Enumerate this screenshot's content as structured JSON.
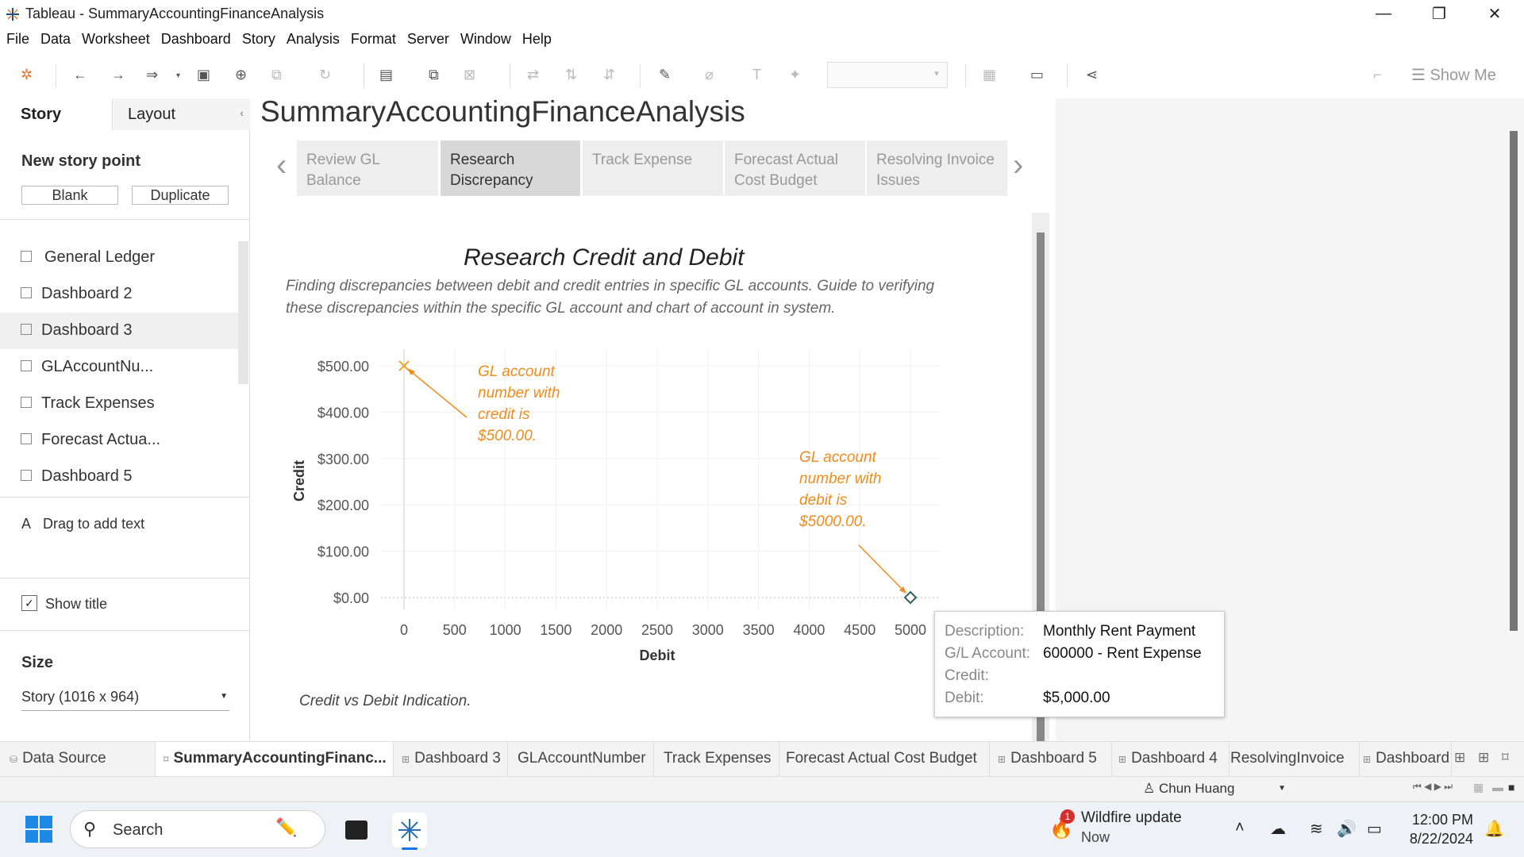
{
  "window": {
    "title": "Tableau - SummaryAccountingFinanceAnalysis"
  },
  "menu": [
    "File",
    "Data",
    "Worksheet",
    "Dashboard",
    "Story",
    "Analysis",
    "Format",
    "Server",
    "Window",
    "Help"
  ],
  "toolbar": {
    "show_me": "Show Me"
  },
  "left_panel": {
    "tab_story": "Story",
    "tab_layout": "Layout",
    "new_story_point": "New story point",
    "blank": "Blank",
    "duplicate": "Duplicate",
    "sheets": [
      "General Ledger",
      "Dashboard 2",
      "Dashboard 3",
      "GLAccountNu...",
      "Track Expenses",
      "Forecast Actua...",
      "Dashboard 5"
    ],
    "drag_text": "Drag to add text",
    "show_title": "Show title",
    "size_title": "Size",
    "size_value": "Story (1016 x 964)"
  },
  "story": {
    "title": "SummaryAccountingFinanceAnalysis",
    "points": [
      {
        "line1": "Review GL",
        "line2": "Balance"
      },
      {
        "line1": "Research",
        "line2": "Discrepancy"
      },
      {
        "line1": "Track Expense",
        "line2": ""
      },
      {
        "line1": "Forecast Actual",
        "line2": "Cost Budget"
      },
      {
        "line1": "Resolving Invoice",
        "line2": "Issues"
      }
    ],
    "active_point": 1
  },
  "chart": {
    "title": "Research Credit and Debit",
    "subtitle": "Finding discrepancies between debit and credit entries in specific GL accounts. Guide to verifying these discrepancies within the specific GL account and chart  of account  in system.",
    "caption": "Credit vs Debit Indication.",
    "annotation_credit": [
      "GL account",
      "number with",
      "credit is",
      "$500.00."
    ],
    "annotation_debit": [
      "GL account",
      "number with",
      "debit is",
      "$5000.00."
    ]
  },
  "chart_data": {
    "type": "scatter",
    "xlabel": "Debit",
    "ylabel": "Credit",
    "xlim": [
      0,
      5000
    ],
    "ylim": [
      0,
      500
    ],
    "xticks": [
      "0",
      "500",
      "1000",
      "1500",
      "2000",
      "2500",
      "3000",
      "3500",
      "4000",
      "4500",
      "5000"
    ],
    "yticks": [
      "$0.00",
      "$100.00",
      "$200.00",
      "$300.00",
      "$400.00",
      "$500.00"
    ],
    "points": [
      {
        "x": 0,
        "y": 500,
        "shape": "x",
        "color": "#f5a623"
      },
      {
        "x": 5000,
        "y": 0,
        "shape": "diamond",
        "color": "#2f5f5a"
      }
    ],
    "grid": true,
    "annotation_color": "#f08c1c"
  },
  "tooltip": {
    "rows": [
      {
        "key": "Description:",
        "value": "Monthly Rent Payment"
      },
      {
        "key": "G/L Account:",
        "value": "600000 - Rent Expense"
      },
      {
        "key": "Credit:",
        "value": ""
      },
      {
        "key": "Debit:",
        "value": "$5,000.00"
      }
    ]
  },
  "sheet_tabs": {
    "data_source": "Data Source",
    "tabs": [
      "SummaryAccountingFinanc...",
      "Dashboard 3",
      "GLAccountNumber",
      "Track Expenses",
      "Forecast Actual Cost Budget",
      "Dashboard 5",
      "Dashboard 4",
      "ResolvingInvoice",
      "Dashboard"
    ]
  },
  "status": {
    "user": "Chun Huang"
  },
  "taskbar": {
    "search": "Search",
    "notification_title": "Wildfire update",
    "notification_sub": "Now",
    "notification_badge": "1",
    "time": "12:00 PM",
    "date": "8/22/2024"
  }
}
